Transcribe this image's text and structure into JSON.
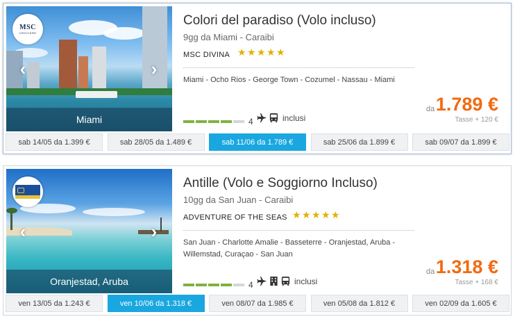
{
  "cruises": [
    {
      "title": "Colori del paradiso (Volo incluso)",
      "subtitle": "9gg da Miami - Caraibi",
      "ship": "MSC DIVINA",
      "stars": 5,
      "itinerary": "Miami - Ocho Rios - George Town - Cozumel - Nassau - Miami",
      "photo_label": "Miami",
      "logo": "MSC",
      "logo_sub": "CROCIERE",
      "rating_value": "4",
      "rating_level": 4,
      "includes_label": "inclusi",
      "includes_icons": [
        "plane-icon",
        "bus-icon"
      ],
      "price_from": "da",
      "price": "1.789 €",
      "taxes": "Tasse + 120 €",
      "dates": [
        {
          "label": "sab 14/05 da 1.399 €",
          "active": false
        },
        {
          "label": "sab 28/05 da 1.489 €",
          "active": false
        },
        {
          "label": "sab 11/06 da 1.789 €",
          "active": true
        },
        {
          "label": "sab 25/06 da 1.899 €",
          "active": false
        },
        {
          "label": "sab 09/07 da 1.899 €",
          "active": false
        }
      ]
    },
    {
      "title": "Antille (Volo e Soggiorno Incluso)",
      "subtitle": "10gg da San Juan - Caraibi",
      "ship": "ADVENTURE OF THE SEAS",
      "stars": 5,
      "itinerary": "San Juan - Charlotte Amalie - Basseterre - Oranjestad, Aruba - Willemstad, Curaçao - San Juan",
      "photo_label": "Oranjestad, Aruba",
      "logo": "Royal Caribbean",
      "rating_value": "4",
      "rating_level": 4,
      "includes_label": "inclusi",
      "includes_icons": [
        "plane-icon",
        "hotel-icon",
        "bus-icon"
      ],
      "price_from": "da",
      "price": "1.318 €",
      "taxes": "Tasse + 168 €",
      "dates": [
        {
          "label": "ven 13/05 da 1.243 €",
          "active": false
        },
        {
          "label": "ven 10/06 da 1.318 €",
          "active": true
        },
        {
          "label": "ven 08/07 da 1.985 €",
          "active": false
        },
        {
          "label": "ven 05/08 da 1.812 €",
          "active": false
        },
        {
          "label": "ven 02/09 da 1.605 €",
          "active": false
        }
      ]
    }
  ],
  "colors": {
    "price": "#f26a10",
    "active_date": "#1aa7e0",
    "star": "#e2b100",
    "rating_bar": "#7cb342"
  }
}
